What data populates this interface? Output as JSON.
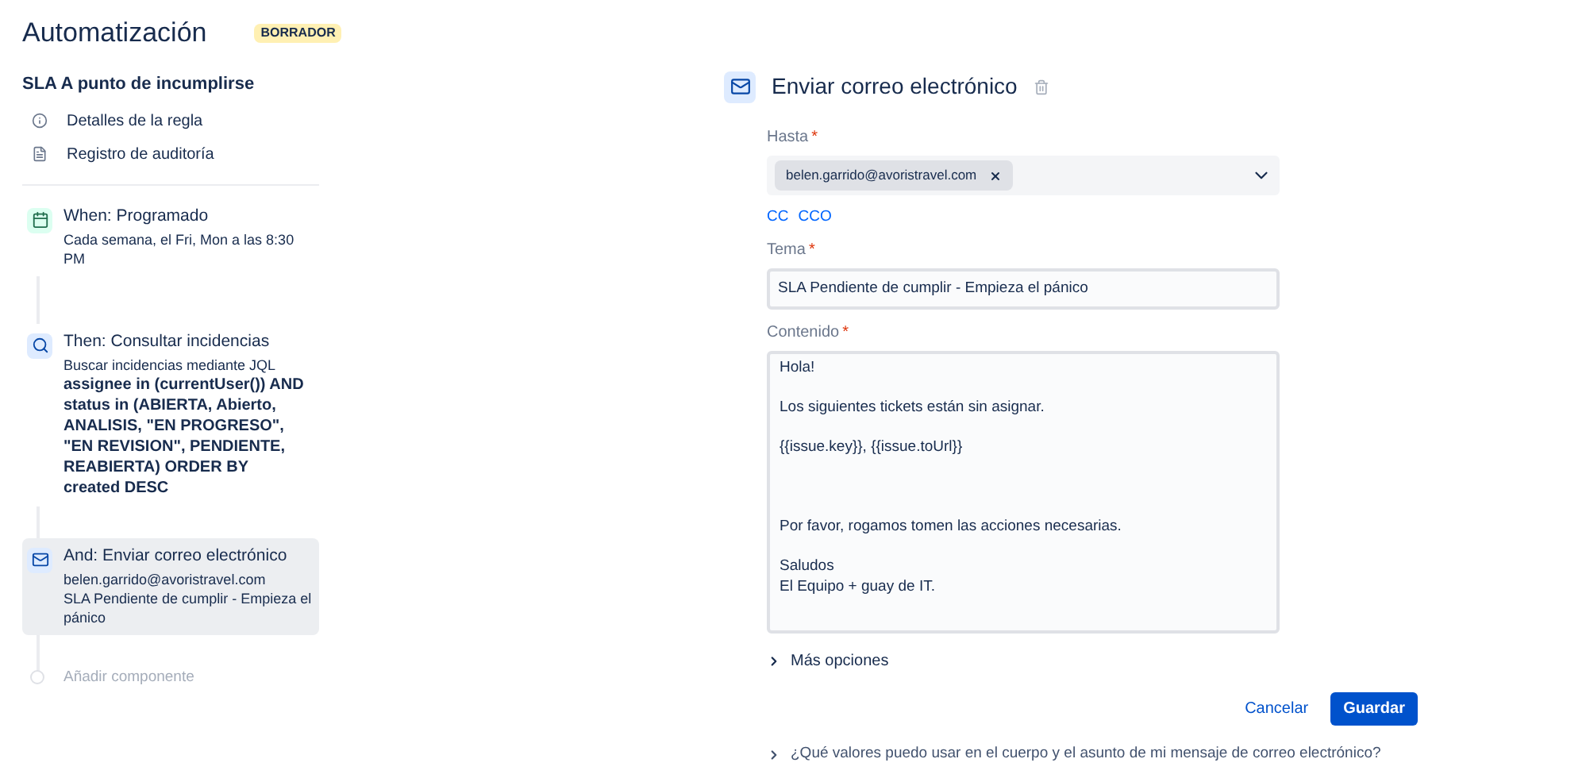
{
  "header": {
    "title": "Automatización",
    "badge": "BORRADOR"
  },
  "rule": {
    "name": "SLA A punto de incumplirse",
    "links": [
      {
        "kind": "info",
        "label": "Detalles de la regla"
      },
      {
        "kind": "audit",
        "label": "Registro de auditoría"
      }
    ]
  },
  "components": [
    {
      "kind": "trigger",
      "title": "When: Programado",
      "selected": false,
      "lines": [
        "Cada semana, el Fri, Mon a las 8:30 PM"
      ]
    },
    {
      "kind": "lookup",
      "title": "Then: Consultar incidencias",
      "selected": false,
      "lines": [
        "Buscar incidencias mediante JQL"
      ],
      "query": "assignee in (currentUser()) AND status in (ABIERTA, Abierto, ANALISIS, \"EN PROGRESO\", \"EN REVISION\", PENDIENTE, REABIERTA) ORDER BY created DESC"
    },
    {
      "kind": "email",
      "title": "And: Enviar correo electrónico",
      "selected": true,
      "lines": [
        "belen.garrido@avoristravel.com",
        "SLA Pendiente de cumplir - Empieza el pánico"
      ]
    }
  ],
  "add_component": "Añadir componente",
  "editor": {
    "title": "Enviar correo electrónico",
    "to": {
      "label": "Hasta",
      "required_mark": "*",
      "recipients": [
        "belen.garrido@avoristravel.com"
      ]
    },
    "cc_links": [
      "CC",
      "CCO"
    ],
    "subject": {
      "label": "Tema",
      "required_mark": "*",
      "value": "SLA Pendiente de cumplir - Empieza el pánico"
    },
    "body": {
      "label": "Contenido",
      "required_mark": "*",
      "value": "Hola!\n\nLos siguientes tickets están sin asignar.\n\n{{issue.key}}, {{issue.toUrl}}\n\n\n\nPor favor, rogamos tomen las acciones necesarias.\n\nSaludos\nEl Equipo + guay de IT."
    },
    "more_options": "Más opciones",
    "buttons": [
      {
        "kind": "subtle",
        "label": "Cancelar"
      },
      {
        "kind": "primary",
        "label": "Guardar"
      }
    ],
    "help": "¿Qué valores puedo usar en el cuerpo y el asunto de mi mensaje de correo electrónico?"
  }
}
